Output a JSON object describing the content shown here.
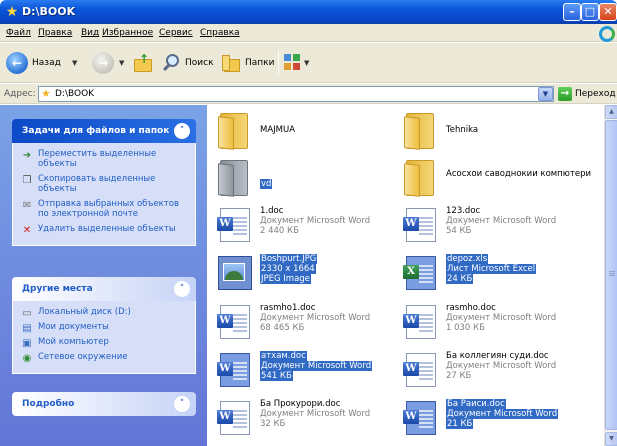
{
  "window": {
    "title": "D:\\BOOK"
  },
  "menu": [
    "Файл",
    "Правка",
    "Вид",
    "Избранное",
    "Сервис",
    "Справка"
  ],
  "toolbar": {
    "back_label": "Назад",
    "search_label": "Поиск",
    "folders_label": "Папки"
  },
  "address": {
    "label": "Адрес:",
    "value": "D:\\BOOK",
    "go_label": "Переход"
  },
  "panels": {
    "tasks": {
      "title": "Задачи для файлов и папок",
      "items": [
        {
          "label": "Переместить выделенные объекты",
          "icon": "move-icon"
        },
        {
          "label": "Скопировать выделенные объекты",
          "icon": "copy-icon"
        },
        {
          "label": "Отправка выбранных объектов по электронной почте",
          "icon": "email-icon"
        },
        {
          "label": "Удалить выделенные объекты",
          "icon": "delete-icon"
        }
      ]
    },
    "places": {
      "title": "Другие места",
      "items": [
        {
          "label": "Локальный диск (D:)",
          "icon": "drive-icon"
        },
        {
          "label": "Мои документы",
          "icon": "documents-icon"
        },
        {
          "label": "Мой компьютер",
          "icon": "computer-icon"
        },
        {
          "label": "Сетевое окружение",
          "icon": "network-icon"
        }
      ]
    },
    "details": {
      "title": "Подробно"
    }
  },
  "files": [
    {
      "name": "MAJMUA",
      "kind": "folder",
      "selected": false
    },
    {
      "name": "Tehnika",
      "kind": "folder",
      "selected": false
    },
    {
      "name": "vd",
      "kind": "folder",
      "selected": true
    },
    {
      "name": "Асосхои саводнокии компютери",
      "kind": "folder",
      "selected": false
    },
    {
      "name": "1.doc",
      "type": "Документ Microsoft Word",
      "size": "2 440 КБ",
      "kind": "word",
      "selected": false
    },
    {
      "name": "123.doc",
      "type": "Документ Microsoft Word",
      "size": "54 КБ",
      "kind": "word",
      "selected": false
    },
    {
      "name": "Boshpurt.JPG",
      "type": "2330 x 1664",
      "size": "JPEG Image",
      "kind": "image",
      "selected": true
    },
    {
      "name": "depoz.xls",
      "type": "Лист Microsoft Excel",
      "size": "24 КБ",
      "kind": "excel",
      "selected": true
    },
    {
      "name": "rasmho1.doc",
      "type": "Документ Microsoft Word",
      "size": "68 465 КБ",
      "kind": "word",
      "selected": false
    },
    {
      "name": "rasmho.doc",
      "type": "Документ Microsoft Word",
      "size": "1 030 КБ",
      "kind": "word",
      "selected": false
    },
    {
      "name": "атхам.doc",
      "type": "Документ Microsoft Word",
      "size": "541 КБ",
      "kind": "word",
      "selected": true
    },
    {
      "name": "Ба коллегиян суди.doc",
      "type": "Документ Microsoft Word",
      "size": "27 КБ",
      "kind": "word",
      "selected": false
    },
    {
      "name": "Ба Прокурори.doc",
      "type": "Документ Microsoft Word",
      "size": "32 КБ",
      "kind": "word",
      "selected": false
    },
    {
      "name": "Ба Раиси.doc",
      "type": "Документ Microsoft Word",
      "size": "21 КБ",
      "kind": "word",
      "selected": true
    }
  ],
  "colors": {
    "titlebar": "#0a54d8",
    "selection": "#316ac5",
    "task_link": "#215dc6"
  }
}
